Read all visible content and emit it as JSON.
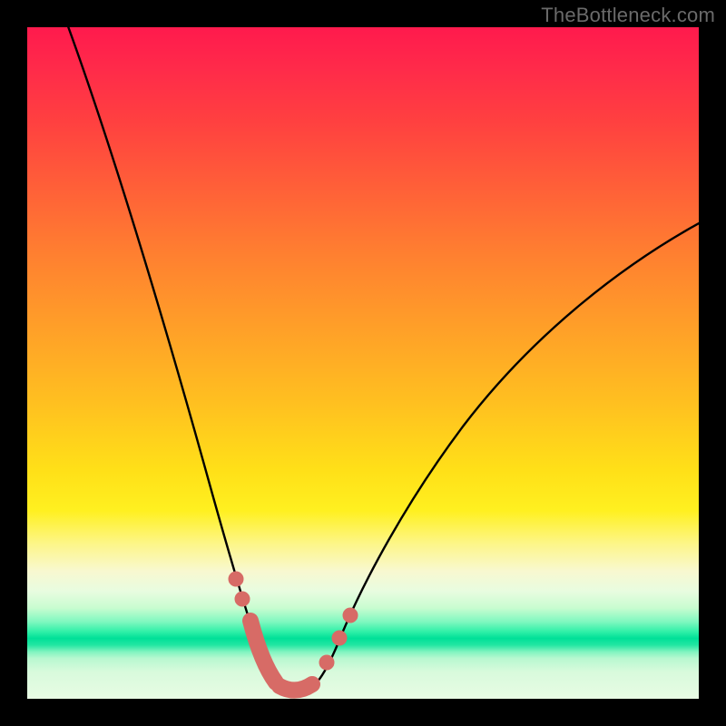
{
  "watermark": "TheBottleneck.com",
  "chart_data": {
    "type": "line",
    "title": "",
    "xlabel": "",
    "ylabel": "",
    "xlim": [
      0,
      100
    ],
    "ylim": [
      0,
      100
    ],
    "series": [
      {
        "name": "curve",
        "x": [
          0,
          5,
          10,
          15,
          20,
          25,
          28,
          30,
          32,
          34,
          36,
          38,
          40,
          42,
          45,
          50,
          55,
          60,
          65,
          70,
          75,
          80,
          85,
          90,
          95,
          100
        ],
        "values": [
          102,
          90,
          77,
          64,
          51,
          36,
          25,
          17,
          10,
          5,
          2,
          0.5,
          0.5,
          2,
          6,
          14,
          22,
          29,
          36,
          42,
          48,
          53,
          58,
          62,
          66,
          70
        ]
      }
    ],
    "annotations": [
      {
        "name": "marker-left-upper",
        "x": 30.5,
        "y": 15
      },
      {
        "name": "marker-left-mid",
        "x": 31.5,
        "y": 11
      },
      {
        "name": "marker-trough-1",
        "x": 33,
        "y": 5
      },
      {
        "name": "marker-trough-2",
        "x": 35,
        "y": 2.2
      },
      {
        "name": "marker-trough-3",
        "x": 37,
        "y": 1
      },
      {
        "name": "marker-trough-4",
        "x": 39,
        "y": 0.8
      },
      {
        "name": "marker-trough-5",
        "x": 41,
        "y": 1.2
      },
      {
        "name": "marker-right-1",
        "x": 44,
        "y": 4.5
      },
      {
        "name": "marker-right-2",
        "x": 46,
        "y": 8
      },
      {
        "name": "marker-right-3",
        "x": 47.5,
        "y": 11
      }
    ],
    "gradient_stops": [
      {
        "pos": 0,
        "color": "#ff1a4d"
      },
      {
        "pos": 50,
        "color": "#ffb028"
      },
      {
        "pos": 78,
        "color": "#fdf68a"
      },
      {
        "pos": 90,
        "color": "#00e098"
      },
      {
        "pos": 100,
        "color": "#e8fce4"
      }
    ]
  }
}
